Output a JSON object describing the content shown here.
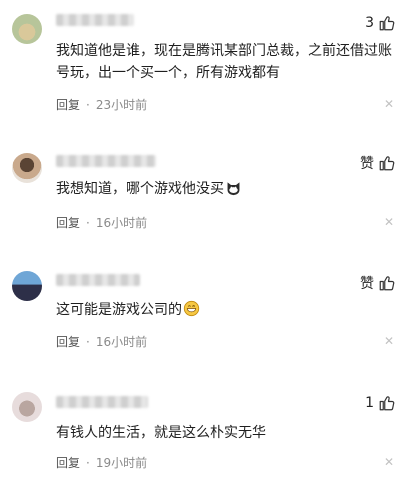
{
  "comments": [
    {
      "likes": "3",
      "text": "我知道他是谁，现在是腾讯某部门总裁，之前还借过账号玩，出一个买一个，所有游戏都有",
      "reply": "回复",
      "dot": "·",
      "time": "23小时前",
      "close": "✕"
    },
    {
      "likes": "赞",
      "text": "我想知道，哪个游戏他没买",
      "emoji": "cat-face-icon",
      "reply": "回复",
      "dot": "·",
      "time": "16小时前",
      "close": "✕"
    },
    {
      "likes": "赞",
      "text": "这可能是游戏公司的",
      "emoji": "grinning-face-icon",
      "reply": "回复",
      "dot": "·",
      "time": "16小时前",
      "close": "✕"
    },
    {
      "likes": "1",
      "text": "有钱人的生活，就是这么朴实无华",
      "reply": "回复",
      "dot": "·",
      "time": "19小时前",
      "close": "✕"
    }
  ]
}
